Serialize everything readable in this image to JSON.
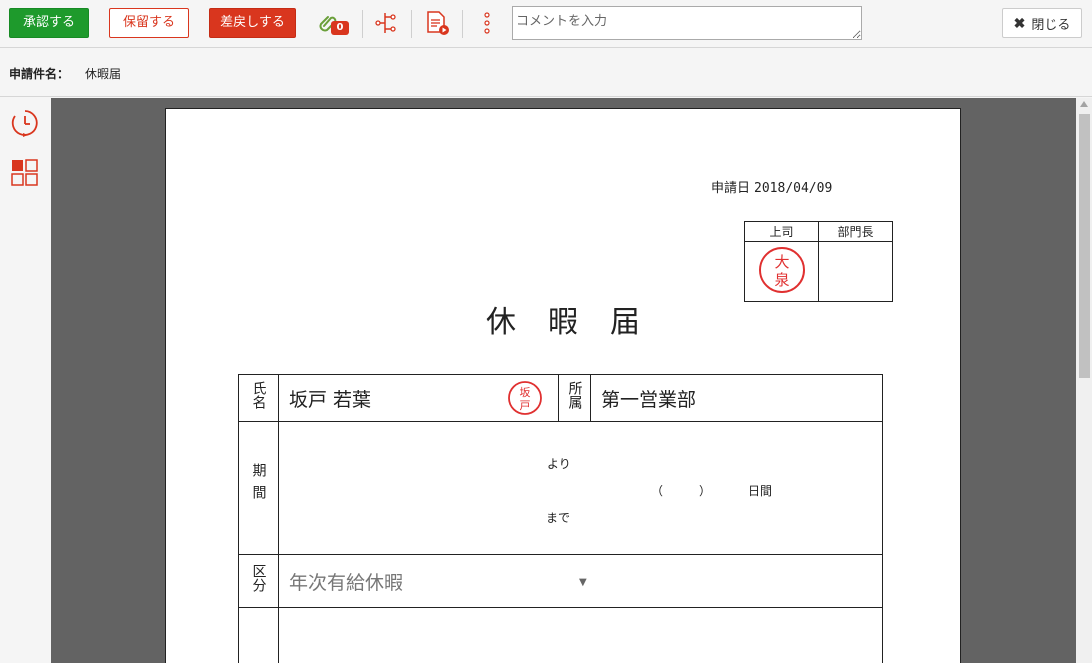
{
  "toolbar": {
    "approve_label": "承認する",
    "hold_label": "保留する",
    "return_label": "差戻しする",
    "attachment_count": "0",
    "comment_placeholder": "コメントを入力",
    "close_label": "閉じる"
  },
  "subject": {
    "label": "申請件名：",
    "value": "休暇届"
  },
  "document": {
    "date_label": "申請日",
    "date_value": "2018/04/09",
    "approval_headers": [
      "上司",
      "部門長"
    ],
    "boss_stamp": "大泉",
    "applicant_stamp": "坂戸",
    "title": "休暇届",
    "name_label": "氏名",
    "name_value": "坂戸 若葉",
    "dept_label": "所属",
    "dept_value": "第一営業部",
    "period_label": "期間",
    "period_from": "より",
    "period_paren": "（　　　）",
    "period_days": "日間",
    "period_to": "まで",
    "type_label": "区分",
    "type_value": "年次有給休暇"
  },
  "colors": {
    "approve": "#1e9a2c",
    "accent_red": "#d9361e",
    "viewer_bg": "#636363"
  }
}
